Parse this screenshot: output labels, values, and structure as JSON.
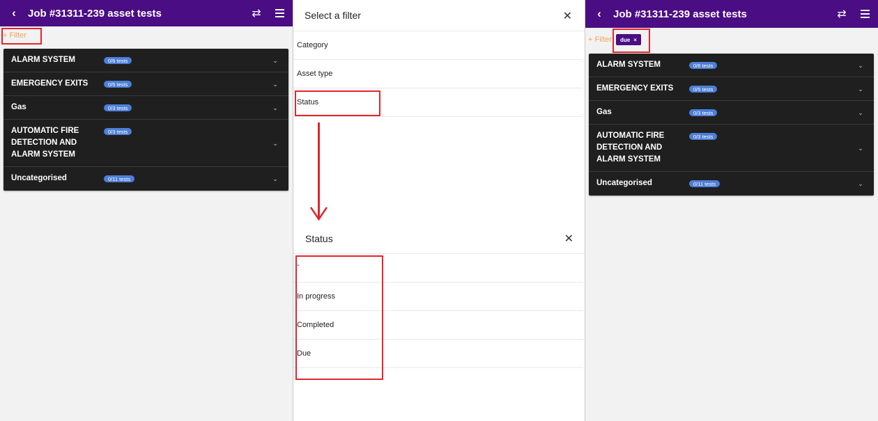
{
  "app": {
    "title": "Job #31311-239 asset tests",
    "back_icon": "chevron-left-icon",
    "swap_icon": "swap-icon",
    "menu_icon": "hamburger-menu-icon",
    "bar_color": "#4a0d84"
  },
  "filter": {
    "link_label": "+ Filter"
  },
  "active_filter": {
    "label": "due",
    "remove": "×"
  },
  "categories": [
    {
      "name": "ALARM SYSTEM",
      "badge": "0/6 tests"
    },
    {
      "name": "EMERGENCY EXITS",
      "badge": "0/5 tests"
    },
    {
      "name": "Gas",
      "badge": "0/3 tests"
    },
    {
      "name": "AUTOMATIC FIRE DETECTION AND ALARM SYSTEM",
      "badge": "0/3 tests"
    },
    {
      "name": "Uncategorised",
      "badge": "0/11 tests"
    }
  ],
  "filter_dialog": {
    "title": "Select a filter",
    "close": "✕",
    "options": [
      "Category",
      "Asset type",
      "Status"
    ]
  },
  "status_dialog": {
    "title": "Status",
    "close": "✕",
    "options": [
      "-",
      "In progress",
      "Completed",
      "Due"
    ]
  },
  "colors": {
    "highlight": "#e3252c",
    "badge": "#4e7fd8",
    "filter_link": "#f5a05f"
  }
}
